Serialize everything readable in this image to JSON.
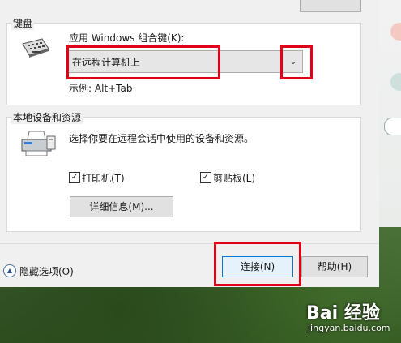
{
  "keyboard": {
    "section_title": "键盘",
    "apply_label": "应用 Windows 组合键(K):",
    "selected_option": "在远程计算机上",
    "example": "示例: Alt+Tab"
  },
  "local_devices": {
    "section_title": "本地设备和资源",
    "description": "选择你要在远程会话中使用的设备和资源。",
    "printer_label": "打印机(T)",
    "clipboard_label": "剪贴板(L)",
    "details_button": "详细信息(M)..."
  },
  "footer": {
    "hide_options": "隐藏选项(O)",
    "connect_button": "连接(N)",
    "help_button": "帮助(H)"
  },
  "watermark": {
    "logo": "Bai 经验",
    "url": "jingyan.baidu.com"
  },
  "colors": {
    "highlight": "#e0001a",
    "dialog_bg": "#f0f0f0",
    "primary_border": "#0078d7"
  }
}
